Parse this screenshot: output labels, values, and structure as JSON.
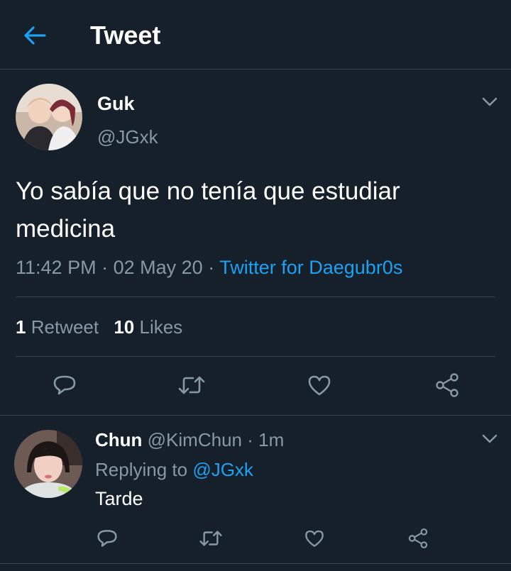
{
  "header": {
    "title": "Tweet"
  },
  "tweet": {
    "name": "Guk",
    "handle": "@JGxk",
    "text": "Yo sabía que no tenía que estudiar medicina",
    "time": "11:42 PM",
    "sep1": "·",
    "date": "02 May 20",
    "sep2": "·",
    "source": "Twitter for Daegubr0s",
    "retweets_count": "1",
    "retweets_label": "Retweet",
    "likes_count": "10",
    "likes_label": "Likes"
  },
  "reply": {
    "name": "Chun",
    "handle": "@KimChun",
    "sep": "·",
    "time": "1m",
    "replying_prefix": "Replying to",
    "replying_handle": "@JGxk",
    "text": "Tarde"
  },
  "icons": {
    "back": "arrow-left-icon",
    "chevron": "chevron-down-icon",
    "reply": "speech-bubble-icon",
    "retweet": "retweet-icon",
    "like": "heart-icon",
    "share": "share-icon"
  },
  "colors": {
    "background": "#15202b",
    "accent": "#1da1f2",
    "muted": "#8899a6",
    "divider": "#38444d"
  }
}
